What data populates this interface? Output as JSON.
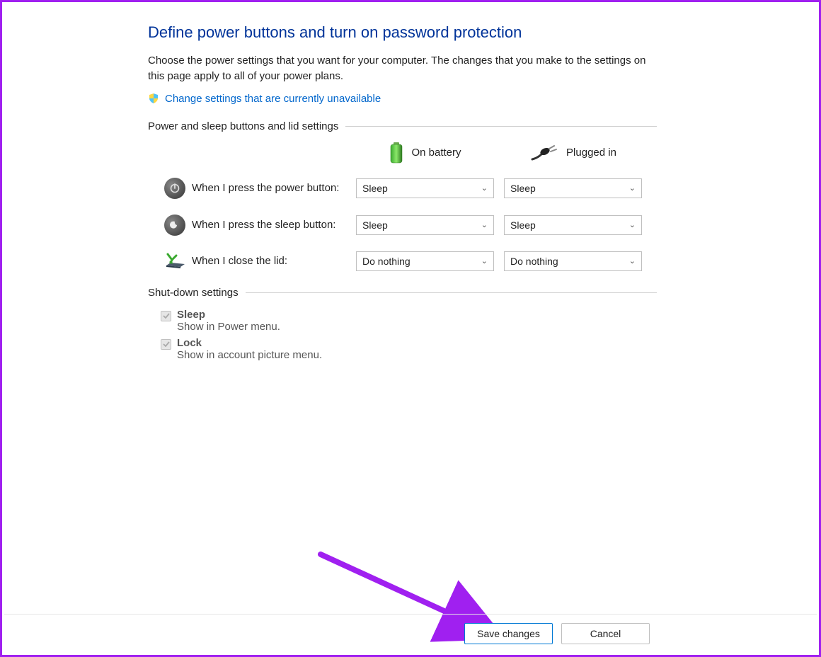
{
  "header": {
    "title": "Define power buttons and turn on password protection",
    "description": "Choose the power settings that you want for your computer. The changes that you make to the settings on this page apply to all of your power plans.",
    "admin_link": "Change settings that are currently unavailable"
  },
  "section_power": {
    "label": "Power and sleep buttons and lid settings",
    "columns": {
      "battery": "On battery",
      "plugged": "Plugged in"
    },
    "rows": {
      "power_button": {
        "label": "When I press the power button:",
        "battery": "Sleep",
        "plugged": "Sleep"
      },
      "sleep_button": {
        "label": "When I press the sleep button:",
        "battery": "Sleep",
        "plugged": "Sleep"
      },
      "close_lid": {
        "label": "When I close the lid:",
        "battery": "Do nothing",
        "plugged": "Do nothing"
      }
    }
  },
  "section_shutdown": {
    "label": "Shut-down settings",
    "items": {
      "sleep": {
        "title": "Sleep",
        "desc": "Show in Power menu."
      },
      "lock": {
        "title": "Lock",
        "desc": "Show in account picture menu."
      }
    }
  },
  "footer": {
    "save": "Save changes",
    "cancel": "Cancel"
  }
}
